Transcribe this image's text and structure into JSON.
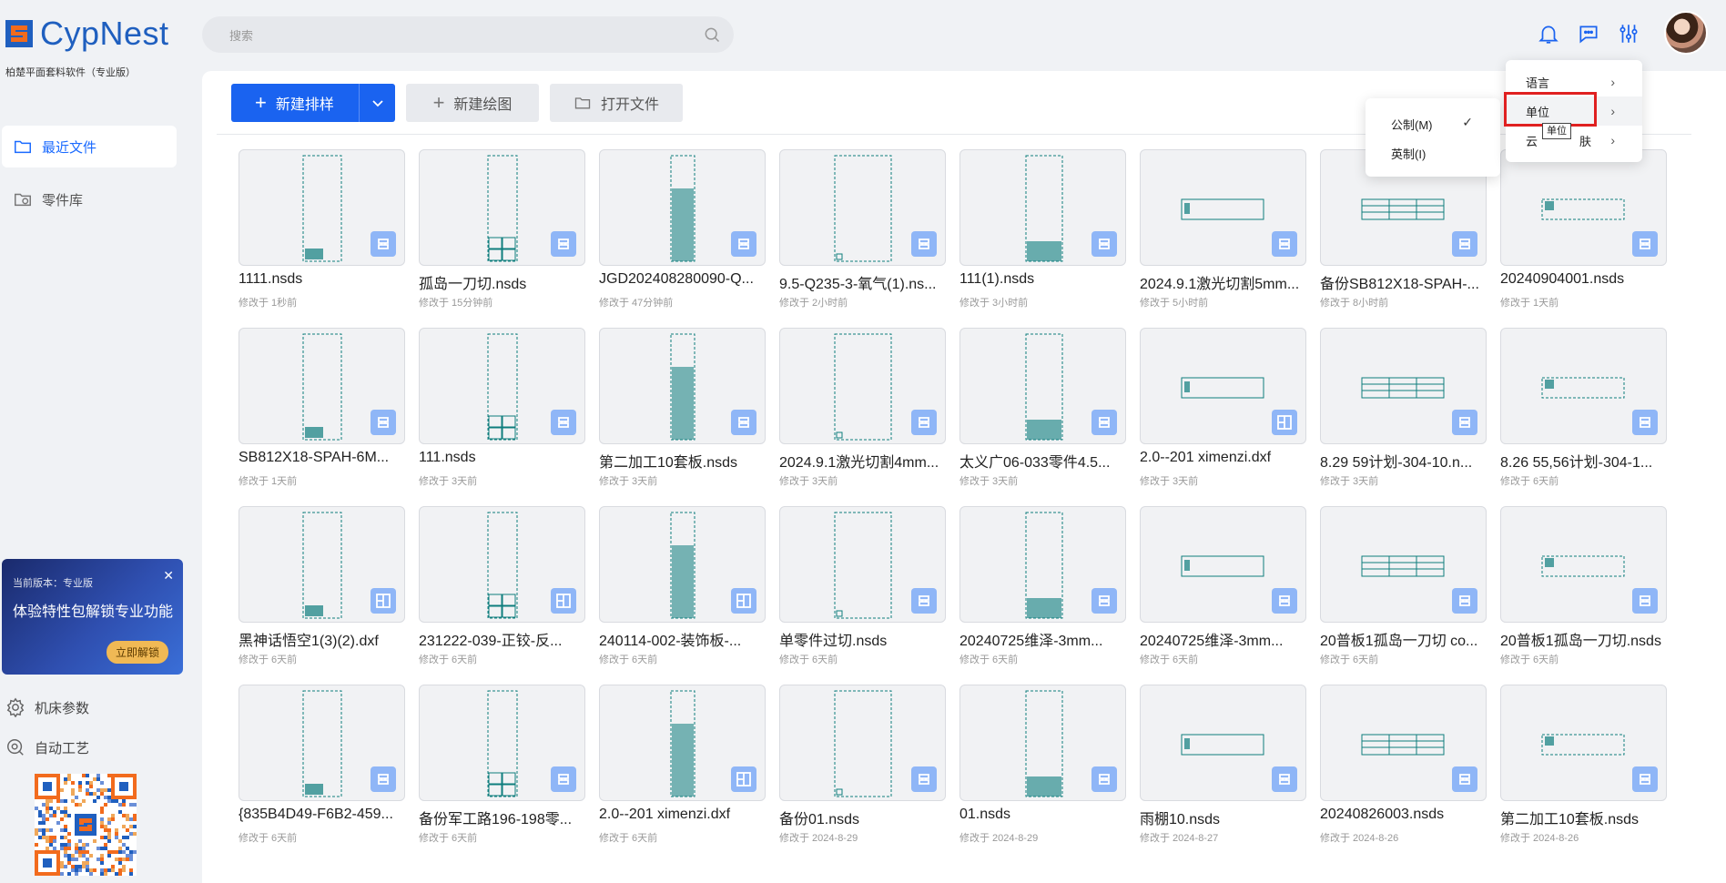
{
  "app": {
    "name": "CypNest",
    "subtitle": "柏楚平面套料软件（专业版）"
  },
  "sidebar": {
    "items": [
      {
        "label": "最近文件",
        "active": true,
        "icon": "folder-icon"
      },
      {
        "label": "零件库",
        "active": false,
        "icon": "part-library-icon"
      }
    ],
    "promo": {
      "version": "当前版本：专业版",
      "title": "体验特性包解锁专业功能",
      "button": "立即解锁"
    },
    "tools": [
      {
        "label": "机床参数",
        "icon": "gear-icon"
      },
      {
        "label": "自动工艺",
        "icon": "auto-process-icon"
      }
    ]
  },
  "search": {
    "placeholder": "搜索"
  },
  "toolbar": {
    "new_nest": "新建排样",
    "new_drawing": "新建绘图",
    "open_file": "打开文件"
  },
  "files": [
    {
      "name": "1111.nsds",
      "modified": "修改于 1秒前",
      "type": "nsds"
    },
    {
      "name": "孤岛一刀切.nsds",
      "modified": "修改于 15分钟前",
      "type": "nsds"
    },
    {
      "name": "JGD202408280090-Q...",
      "modified": "修改于 47分钟前",
      "type": "nsds"
    },
    {
      "name": "9.5-Q235-3-氧气(1).ns...",
      "modified": "修改于 2小时前",
      "type": "nsds"
    },
    {
      "name": "111(1).nsds",
      "modified": "修改于 3小时前",
      "type": "nsds"
    },
    {
      "name": "2024.9.1激光切割5mm...",
      "modified": "修改于 5小时前",
      "type": "nsds"
    },
    {
      "name": "备份SB812X18-SPAH-...",
      "modified": "修改于 8小时前",
      "type": "nsds"
    },
    {
      "name": "20240904001.nsds",
      "modified": "修改于 1天前",
      "type": "nsds"
    },
    {
      "name": "SB812X18-SPAH-6M...",
      "modified": "修改于 1天前",
      "type": "nsds"
    },
    {
      "name": "111.nsds",
      "modified": "修改于 3天前",
      "type": "nsds"
    },
    {
      "name": "第二加工10套板.nsds",
      "modified": "修改于 3天前",
      "type": "nsds"
    },
    {
      "name": "2024.9.1激光切割4mm...",
      "modified": "修改于 3天前",
      "type": "nsds"
    },
    {
      "name": "太义广06-033零件4.5...",
      "modified": "修改于 3天前",
      "type": "nsds"
    },
    {
      "name": "2.0--201 ximenzi.dxf",
      "modified": "修改于 3天前",
      "type": "dxf"
    },
    {
      "name": "8.29 59计划-304-10.n...",
      "modified": "修改于 3天前",
      "type": "nsds"
    },
    {
      "name": "8.26 55,56计划-304-1...",
      "modified": "修改于 6天前",
      "type": "nsds"
    },
    {
      "name": "黑神话悟空1(3)(2).dxf",
      "modified": "修改于 6天前",
      "type": "dxf"
    },
    {
      "name": "231222-039-正铰-反...",
      "modified": "修改于 6天前",
      "type": "dxf"
    },
    {
      "name": "240114-002-装饰板-...",
      "modified": "修改于 6天前",
      "type": "dxf"
    },
    {
      "name": "单零件过切.nsds",
      "modified": "修改于 6天前",
      "type": "nsds"
    },
    {
      "name": "20240725维泽-3mm...",
      "modified": "修改于 6天前",
      "type": "nsds"
    },
    {
      "name": "20240725维泽-3mm...",
      "modified": "修改于 6天前",
      "type": "nsds"
    },
    {
      "name": "20普板1孤岛一刀切 co...",
      "modified": "修改于 6天前",
      "type": "nsds"
    },
    {
      "name": "20普板1孤岛一刀切.nsds",
      "modified": "修改于 6天前",
      "type": "nsds"
    },
    {
      "name": "{835B4D49-F6B2-459...",
      "modified": "修改于 6天前",
      "type": "nsds"
    },
    {
      "name": "备份军工路196-198零...",
      "modified": "修改于 6天前",
      "type": "nsds"
    },
    {
      "name": "2.0--201 ximenzi.dxf",
      "modified": "修改于 6天前",
      "type": "dxf"
    },
    {
      "name": "备份01.nsds",
      "modified": "修改于 2024-8-29",
      "type": "nsds"
    },
    {
      "name": "01.nsds",
      "modified": "修改于 2024-8-29",
      "type": "nsds"
    },
    {
      "name": "雨棚10.nsds",
      "modified": "修改于 2024-8-27",
      "type": "nsds"
    },
    {
      "name": "20240826003.nsds",
      "modified": "修改于 2024-8-26",
      "type": "nsds"
    },
    {
      "name": "第二加工10套板.nsds",
      "modified": "修改于 2024-8-26",
      "type": "nsds"
    }
  ],
  "settings_menu": {
    "items": [
      {
        "label": "语言"
      },
      {
        "label": "单位"
      },
      {
        "label": "云",
        "label_tail": "肤"
      }
    ],
    "tooltip": "单位"
  },
  "unit_submenu": {
    "items": [
      {
        "label": "公制(M)",
        "checked": true
      },
      {
        "label": "英制(I)",
        "checked": false
      }
    ]
  },
  "colors": {
    "accent": "#1a63f0",
    "drawing": "#0e7d7d",
    "badge": "#8fb6f7",
    "highlight": "#e02020"
  }
}
